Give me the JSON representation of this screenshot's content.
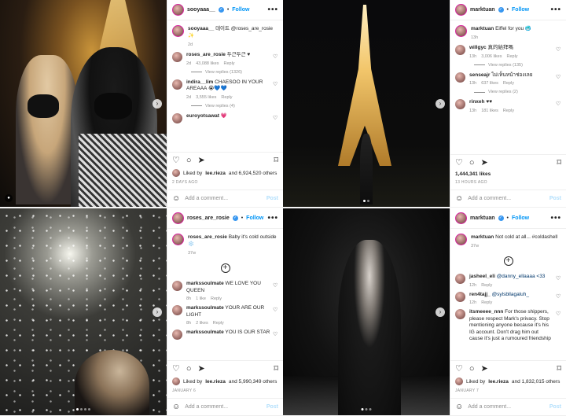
{
  "posts": [
    {
      "username": "sooyaaa__",
      "follow_label": "Follow",
      "caption_user": "sooyaaa__",
      "caption_text": "데이트 @roses_are_rosie ✨",
      "caption_time": "2d",
      "comments": [
        {
          "user": "roses_are_rosie",
          "text": "두근두근 ♥",
          "time": "2d",
          "likes": "43,088 likes",
          "reply": "Reply",
          "view_replies": "View replies (1326)"
        },
        {
          "user": "indira__lim",
          "text": "CHAESOO IN YOUR AREAAA 😭💙💙",
          "time": "2d",
          "likes": "3,555 likes",
          "reply": "Reply",
          "view_replies": "View replies (4)"
        },
        {
          "user": "euroyotsawat",
          "text": "💗",
          "time": "",
          "likes": "",
          "reply": "",
          "view_replies": ""
        }
      ],
      "liked_by_prefix": "Liked by",
      "liked_by_user": "lee.rieza",
      "liked_by_suffix": "and 6,924,520 others",
      "date": "2 DAYS AGO",
      "add_comment_placeholder": "Add a comment...",
      "post_button": "Post"
    },
    {
      "username": "roses_are_rosie",
      "follow_label": "Follow",
      "caption_user": "roses_are_rosie",
      "caption_text": "Baby it's cold outside ❄️",
      "caption_time": "37w",
      "comments": [
        {
          "user": "markssoulmate",
          "text": "WE LOVE YOU QUEEN",
          "time": "8h",
          "likes": "1 like",
          "reply": "Reply",
          "view_replies": ""
        },
        {
          "user": "markssoulmate",
          "text": "YOUR ARE OUR LIGHT",
          "time": "8h",
          "likes": "2 likes",
          "reply": "Reply",
          "view_replies": ""
        },
        {
          "user": "markssoulmate",
          "text": "YOU IS OUR STAR",
          "time": "",
          "likes": "",
          "reply": "",
          "view_replies": ""
        }
      ],
      "liked_by_prefix": "Liked by",
      "liked_by_user": "lee.rieza",
      "liked_by_suffix": "and 5,990,349 others",
      "date": "JANUARY 6",
      "add_comment_placeholder": "Add a comment...",
      "post_button": "Post"
    },
    {
      "username": "marktuan",
      "follow_label": "Follow",
      "caption_user": "marktuan",
      "caption_text": "Eiffel for you 🥶",
      "caption_time": "13h",
      "comments": [
        {
          "user": "willgyc",
          "text": "真的給拜嗎",
          "time": "13h",
          "likes": "3,006 likes",
          "reply": "Reply",
          "view_replies": "View replies (135)"
        },
        {
          "user": "senseajr",
          "text": "ไม่เห็นหน้าช่องเลย",
          "time": "13h",
          "likes": "637 likes",
          "reply": "Reply",
          "view_replies": "View replies (2)"
        },
        {
          "user": "rinxeh",
          "text": "♥♥",
          "time": "13h",
          "likes": "181 likes",
          "reply": "Reply",
          "view_replies": ""
        }
      ],
      "likes_count": "1,444,341 likes",
      "date": "13 HOURS AGO",
      "add_comment_placeholder": "Add a comment...",
      "post_button": "Post"
    },
    {
      "username": "marktuan",
      "follow_label": "Follow",
      "caption_user": "marktuan",
      "caption_text": "Not cold at all... #coldashell",
      "caption_time": "37w",
      "comments": [
        {
          "user": "jasheel_eli",
          "text": "@danny_ellaaaa <33",
          "time": "12h",
          "likes": "",
          "reply": "Reply",
          "view_replies": ""
        },
        {
          "user": "ren4tajj_",
          "text": "@sylsbllagaluh_",
          "time": "12h",
          "likes": "",
          "reply": "Reply",
          "view_replies": ""
        },
        {
          "user": "itsmeeee_nnn",
          "text": "For those shippers, please respect Mark's privacy. Stop mentioning anyone because it's his IG account. Don't drag him out cause it's just a rumoured friendship",
          "time": "",
          "likes": "",
          "reply": "",
          "view_replies": ""
        }
      ],
      "liked_by_prefix": "Liked by",
      "liked_by_user": "lee.rieza",
      "liked_by_suffix": "and 1,832,015 others",
      "date": "JANUARY 7",
      "add_comment_placeholder": "Add a comment...",
      "post_button": "Post"
    }
  ],
  "icons": {
    "more": "•••",
    "heart": "♡",
    "comment": "○",
    "share": "➤",
    "save": "⌑",
    "emoji": "☺",
    "next": "›",
    "add": "+"
  }
}
